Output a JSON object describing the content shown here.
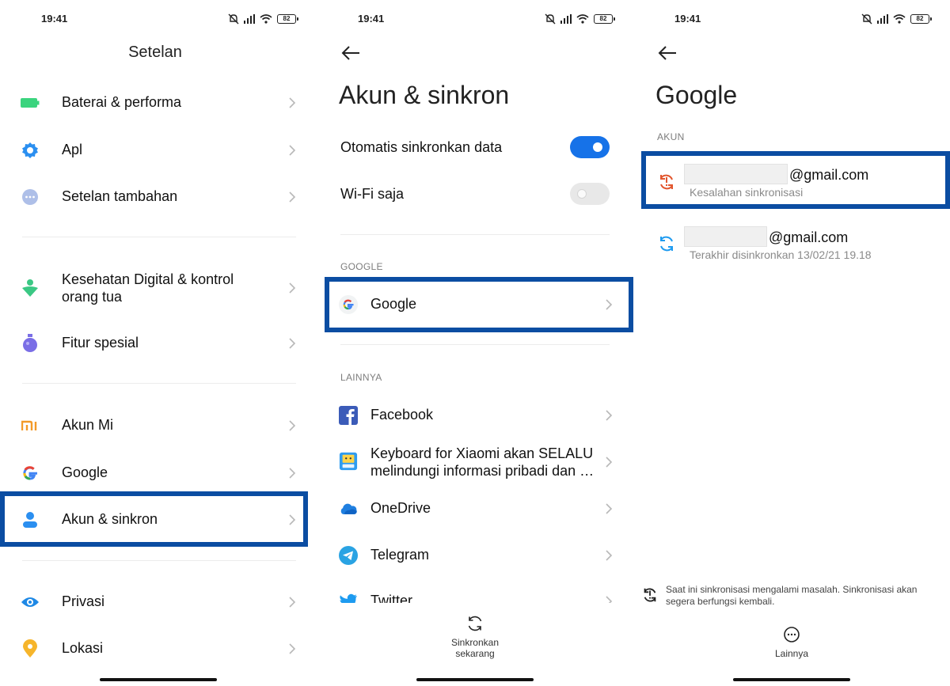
{
  "status": {
    "time": "19:41",
    "battery": "82"
  },
  "panel1": {
    "title": "Setelan",
    "items": [
      {
        "label": "Baterai & performa",
        "icon": "battery-icon"
      },
      {
        "label": "Apl",
        "icon": "gear-icon"
      },
      {
        "label": "Setelan tambahan",
        "icon": "more-dots-icon"
      },
      {
        "label": "Kesehatan Digital & kontrol orang tua",
        "icon": "digital-wellbeing-icon"
      },
      {
        "label": "Fitur spesial",
        "icon": "special-features-icon"
      },
      {
        "label": "Akun Mi",
        "icon": "mi-logo-icon"
      },
      {
        "label": "Google",
        "icon": "google-g-icon"
      },
      {
        "label": "Akun & sinkron",
        "icon": "person-icon"
      },
      {
        "label": "Privasi",
        "icon": "eye-icon"
      },
      {
        "label": "Lokasi",
        "icon": "location-pin-icon"
      }
    ]
  },
  "panel2": {
    "title": "Akun & sinkron",
    "auto_sync_label": "Otomatis sinkronkan data",
    "auto_sync_on": true,
    "wifi_only_label": "Wi-Fi saja",
    "wifi_only_on": false,
    "google_header": "GOOGLE",
    "google_label": "Google",
    "other_header": "LAINNYA",
    "apps": [
      {
        "label": "Facebook",
        "icon": "facebook-icon"
      },
      {
        "label": "Keyboard for Xiaomi akan SELALU melindungi informasi pribadi dan …",
        "icon": "keyboard-icon"
      },
      {
        "label": "OneDrive",
        "icon": "onedrive-icon"
      },
      {
        "label": "Telegram",
        "icon": "telegram-icon"
      },
      {
        "label": "Twitter",
        "icon": "twitter-icon"
      }
    ],
    "sync_now_label": "Sinkronkan sekarang"
  },
  "panel3": {
    "title": "Google",
    "section_header": "AKUN",
    "accounts": [
      {
        "email_suffix": "@gmail.com",
        "status": "Kesalahan sinkronisasi",
        "icon": "sync-error-icon"
      },
      {
        "email_suffix": "@gmail.com",
        "status": "Terakhir disinkronkan 13/02/21 19.18",
        "icon": "sync-icon"
      }
    ],
    "notice": "Saat ini sinkronisasi mengalami masalah. Sinkronisasi akan segera berfungsi kembali.",
    "more_label": "Lainnya"
  },
  "colors": {
    "highlight": "#0b4da2",
    "toggle_on": "#1672e8",
    "accent_blue": "#1e88e5"
  }
}
